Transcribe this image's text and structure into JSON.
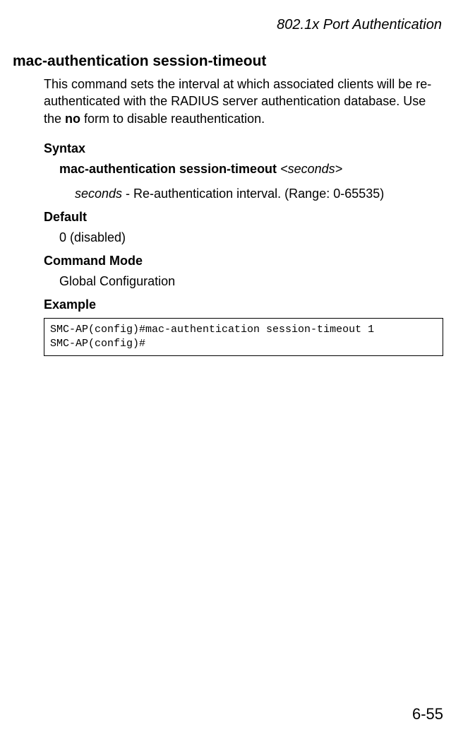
{
  "header": {
    "running_title": "802.1x Port Authentication"
  },
  "section": {
    "title": "mac-authentication session-timeout",
    "intro_pre": "This command sets the interval at which associated clients will be re-authenticated with the RADIUS server authentication database. Use the ",
    "intro_bold": "no",
    "intro_post": " form to disable reauthentication."
  },
  "syntax": {
    "label": "Syntax",
    "command": "mac-authentication session-timeout",
    "arg": "<seconds>",
    "param_name": "seconds",
    "param_desc": " - Re-authentication interval. (Range: 0-65535)"
  },
  "default": {
    "label": "Default",
    "value": "0 (disabled)"
  },
  "command_mode": {
    "label": "Command Mode",
    "value": "Global Configuration"
  },
  "example": {
    "label": "Example",
    "code": "SMC-AP(config)#mac-authentication session-timeout 1\nSMC-AP(config)#"
  },
  "footer": {
    "page_number": "6-55"
  }
}
